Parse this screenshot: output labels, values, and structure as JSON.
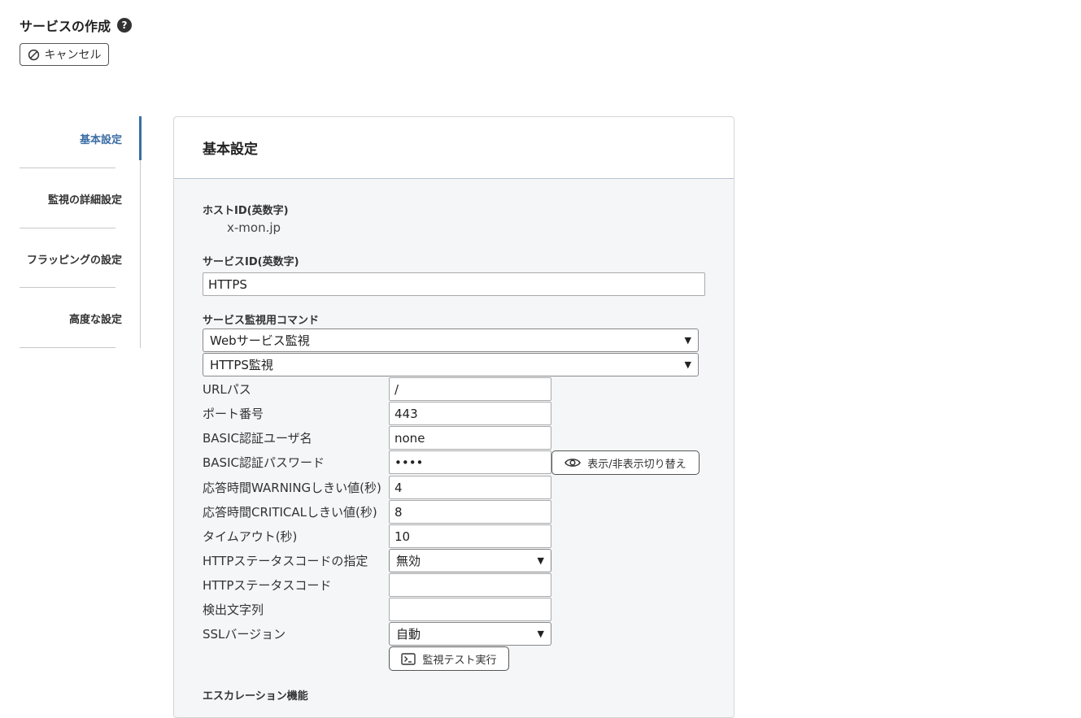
{
  "header": {
    "title": "サービスの作成",
    "help_icon": "?",
    "cancel_label": "キャンセル"
  },
  "side_nav": {
    "items": [
      {
        "label": "基本設定",
        "active": true
      },
      {
        "label": "監視の詳細設定",
        "active": false
      },
      {
        "label": "フラッピングの設定",
        "active": false
      },
      {
        "label": "高度な設定",
        "active": false
      }
    ]
  },
  "panel": {
    "title": "基本設定",
    "host_id": {
      "label": "ホストID(英数字)",
      "value": "x-mon.jp"
    },
    "service_id": {
      "label": "サービスID(英数字)",
      "value": "HTTPS"
    },
    "command": {
      "label": "サービス監視用コマンド",
      "category": "Webサービス監視",
      "plugin": "HTTPS監視"
    },
    "params": [
      {
        "label": "URLパス",
        "type": "input",
        "value": "/"
      },
      {
        "label": "ポート番号",
        "type": "input",
        "value": "443"
      },
      {
        "label": "BASIC認証ユーザ名",
        "type": "input",
        "value": "none"
      },
      {
        "label": "BASIC認証パスワード",
        "type": "password",
        "value": "••••"
      },
      {
        "label": "応答時間WARNINGしきい値(秒)",
        "type": "input",
        "value": "4"
      },
      {
        "label": "応答時間CRITICALしきい値(秒)",
        "type": "input",
        "value": "8"
      },
      {
        "label": "タイムアウト(秒)",
        "type": "input",
        "value": "10"
      },
      {
        "label": "HTTPステータスコードの指定",
        "type": "select",
        "value": "無効"
      },
      {
        "label": "HTTPステータスコード",
        "type": "input",
        "value": ""
      },
      {
        "label": "検出文字列",
        "type": "input",
        "value": ""
      },
      {
        "label": "SSLバージョン",
        "type": "select",
        "value": "自動"
      }
    ],
    "toggle_password_label": "表示/非表示切り替え",
    "test_button_label": "監視テスト実行",
    "escalation_label": "エスカレーション機能"
  }
}
